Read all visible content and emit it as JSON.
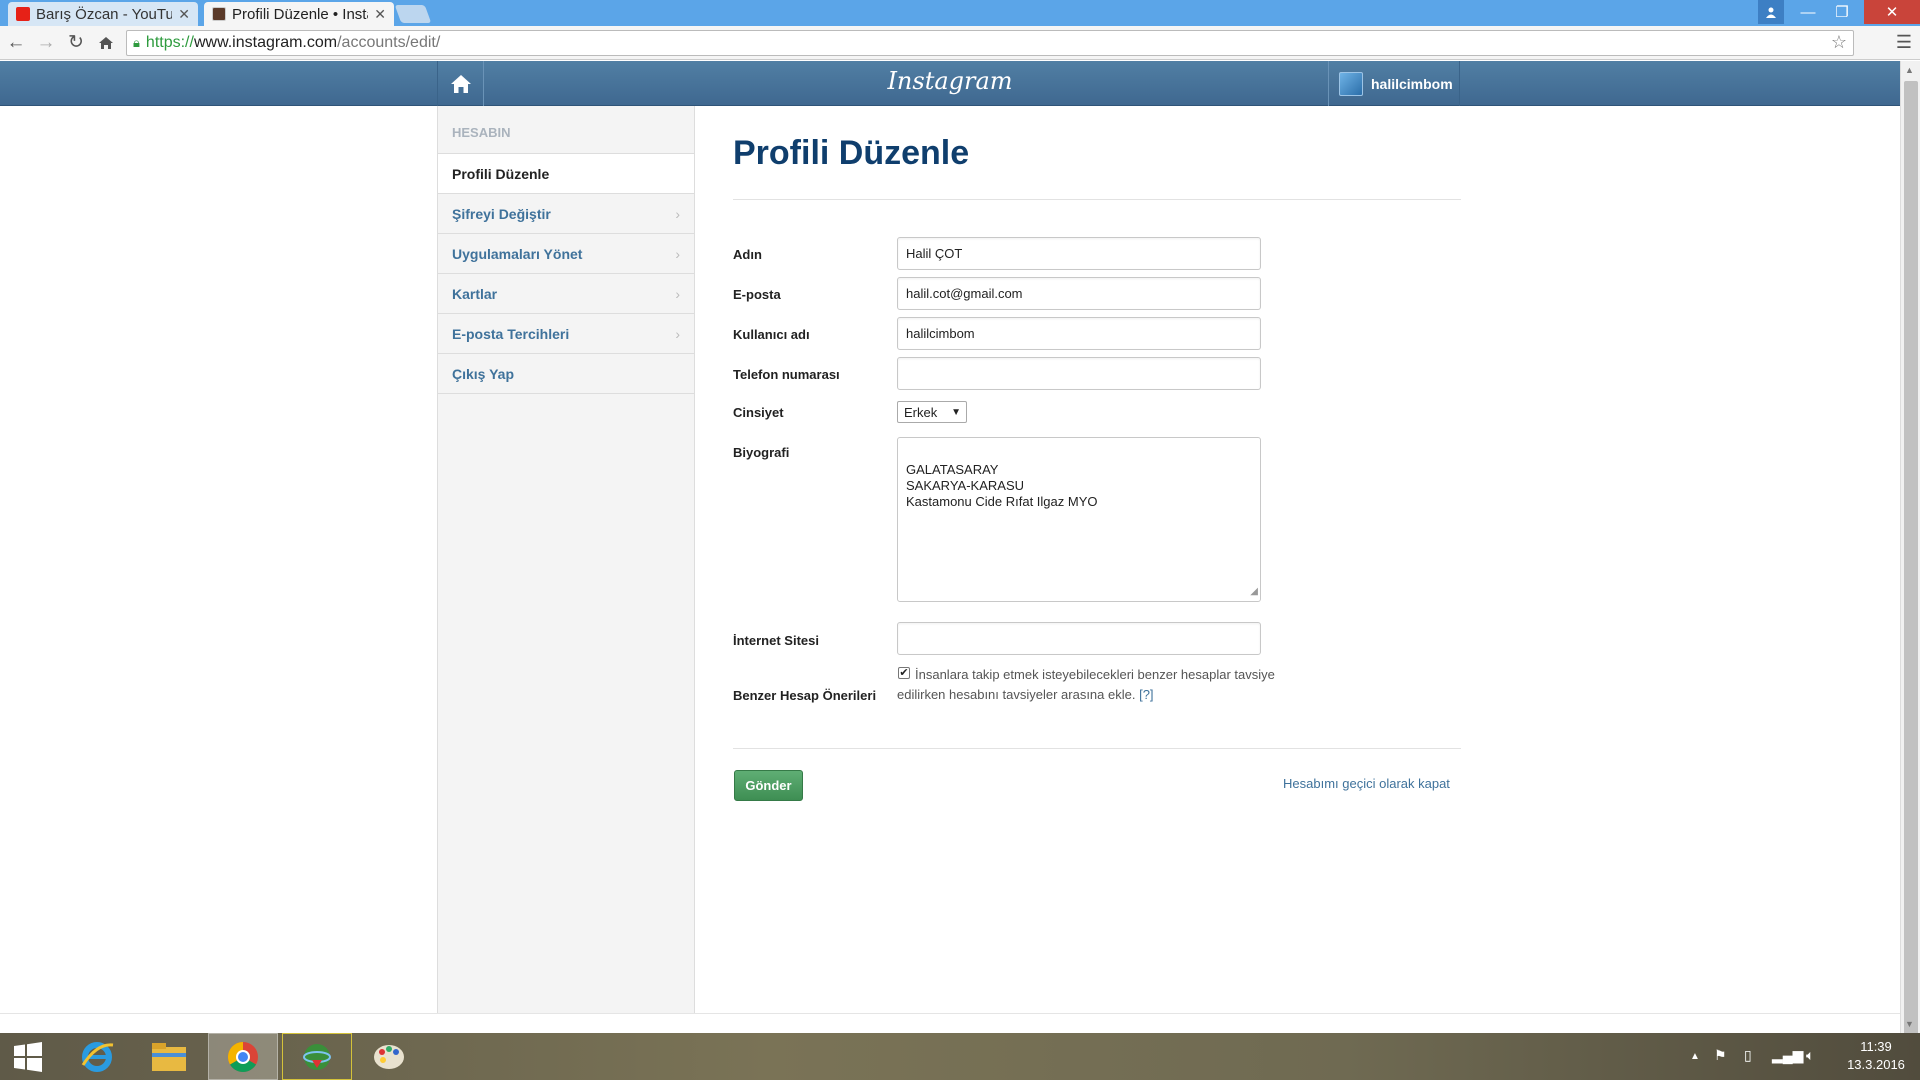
{
  "browser": {
    "tabs": [
      {
        "title": "Barış Özcan - YouTub",
        "favicon_color": "#e62117"
      },
      {
        "title": "Profili Düzenle • Insta",
        "favicon_color": "#5b3a29"
      }
    ],
    "url": {
      "scheme": "https://",
      "host": "www.instagram.com",
      "path": "/accounts/edit/"
    }
  },
  "instagram": {
    "logo": "Instagram",
    "username": "halilcimbom"
  },
  "sidebar": {
    "heading": "HESABIN",
    "items": [
      {
        "label": "Profili Düzenle",
        "active": true
      },
      {
        "label": "Şifreyi Değiştir"
      },
      {
        "label": "Uygulamaları Yönet"
      },
      {
        "label": "Kartlar"
      },
      {
        "label": "E-posta Tercihleri"
      },
      {
        "label": "Çıkış Yap"
      }
    ]
  },
  "form": {
    "title": "Profili Düzenle",
    "name": {
      "label": "Adın",
      "value": "Halil ÇOT"
    },
    "email": {
      "label": "E-posta",
      "value": "halil.cot@gmail.com"
    },
    "username": {
      "label": "Kullanıcı adı",
      "value": "halilcimbom"
    },
    "phone": {
      "label": "Telefon numarası",
      "value": ""
    },
    "gender": {
      "label": "Cinsiyet",
      "value": "Erkek"
    },
    "bio": {
      "label": "Biyografi",
      "value": "GALATASARAY\nSAKARYA-KARASU\nKastamonu Cide Rıfat Ilgaz MYO"
    },
    "website": {
      "label": "İnternet Sitesi",
      "value": ""
    },
    "suggestions": {
      "label": "Benzer Hesap Önerileri",
      "checked": true,
      "text": "İnsanlara takip etmek isteyebilecekleri benzer hesaplar tavsiye edilirken hesabını tavsiyeler arasına ekle.",
      "help": "[?]"
    },
    "submit_label": "Gönder",
    "disable_link": "Hesabımı geçici olarak kapat"
  },
  "taskbar": {
    "time": "11:39",
    "date": "13.3.2016"
  },
  "colors": {
    "ig_header": "#517fa4",
    "link": "#3f729b",
    "title": "#0f3e6d",
    "submit": "#4b9a60"
  }
}
